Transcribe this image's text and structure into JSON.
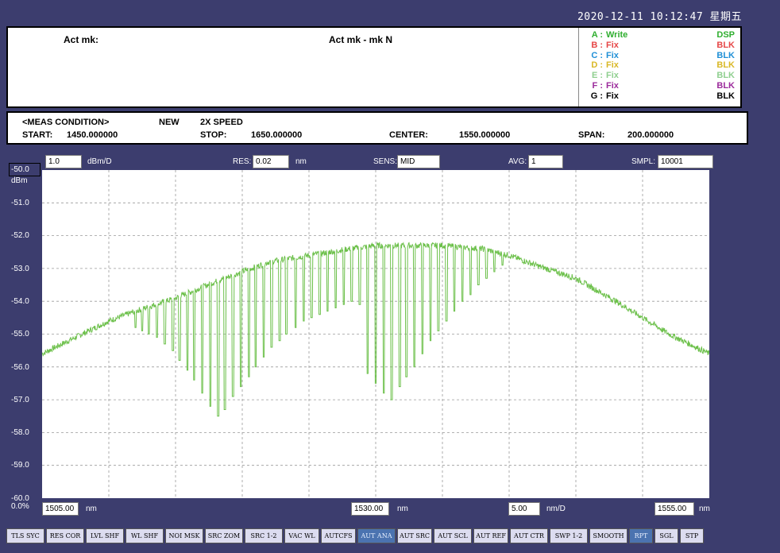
{
  "header": {
    "datetime": "2020-12-11 10:12:47 星期五"
  },
  "markers": {
    "act_mk": "Act mk:",
    "act_mk_n": "Act mk - mk N"
  },
  "traces": [
    {
      "letter": "A :",
      "mode": "Write",
      "display": "DSP",
      "color": "#2fae2f"
    },
    {
      "letter": "B :",
      "mode": "Fix",
      "display": "BLK",
      "color": "#e64646"
    },
    {
      "letter": "C :",
      "mode": "Fix",
      "display": "BLK",
      "color": "#1f8fd6"
    },
    {
      "letter": "D :",
      "mode": "Fix",
      "display": "BLK",
      "color": "#d9b826"
    },
    {
      "letter": "E :",
      "mode": "Fix",
      "display": "BLK",
      "color": "#8fcf8f"
    },
    {
      "letter": "F :",
      "mode": "Fix",
      "display": "BLK",
      "color": "#9b2a9b"
    },
    {
      "letter": "G :",
      "mode": "Fix",
      "display": "BLK",
      "color": "#000000"
    }
  ],
  "condition": {
    "title": "<MEAS CONDITION>",
    "new": "NEW",
    "speed": "2X SPEED",
    "start_label": "START:",
    "start": "1450.000000",
    "stop_label": "STOP:",
    "stop": "1650.000000",
    "center_label": "CENTER:",
    "center": "1550.000000",
    "span_label": "SPAN:",
    "span": "200.000000"
  },
  "top_fields": {
    "level_scale": "1.0",
    "level_unit": "dBm/D",
    "res_label": "RES:",
    "res": "0.02",
    "res_unit": "nm",
    "sens_label": "SENS:",
    "sens": "MID",
    "avg_label": "AVG:",
    "avg": "1",
    "smpl_label": "SMPL:",
    "smpl": "10001"
  },
  "y_axis": {
    "ref": "-50.0",
    "unit": "dBm",
    "ticks": [
      "-51.0",
      "-52.0",
      "-53.0",
      "-54.0",
      "-55.0",
      "-56.0",
      "-57.0",
      "-58.0",
      "-59.0",
      "-60.0"
    ],
    "bottom": "0.0%"
  },
  "bottom_fields": {
    "start": "1505.00",
    "start_unit": "nm",
    "center": "1530.00",
    "center_unit": "nm",
    "scale": "5.00",
    "scale_unit": "nm/D",
    "stop": "1555.00",
    "stop_unit": "nm"
  },
  "buttons": [
    {
      "label": "TLS SYC",
      "active": false
    },
    {
      "label": "RES COR",
      "active": false
    },
    {
      "label": "LVL SHF",
      "active": false
    },
    {
      "label": "WL SHF",
      "active": false
    },
    {
      "label": "NOI MSK",
      "active": false
    },
    {
      "label": "SRC ZOM",
      "active": false
    },
    {
      "label": "SRC 1-2",
      "active": false
    },
    {
      "label": "VAC WL",
      "active": false
    },
    {
      "label": "AUTCFS",
      "active": false
    },
    {
      "label": "AUT ANA",
      "active": true
    },
    {
      "label": "AUT SRC",
      "active": false
    },
    {
      "label": "AUT SCL",
      "active": false
    },
    {
      "label": "AUT REF",
      "active": false
    },
    {
      "label": "AUT CTR",
      "active": false
    },
    {
      "label": "SWP 1-2",
      "active": false
    },
    {
      "label": "SMOOTH",
      "active": false
    },
    {
      "label": "RPT",
      "active": true
    },
    {
      "label": "SGL",
      "active": false
    },
    {
      "label": "STP",
      "active": false
    }
  ],
  "chart_data": {
    "type": "line",
    "title": "",
    "xlabel": "nm",
    "ylabel": "dBm",
    "xlim": [
      1505,
      1555
    ],
    "ylim": [
      -60,
      -50
    ],
    "grid": true,
    "series": [
      {
        "color": "#6cc04a",
        "envelope_x": [
          1505,
          1508,
          1510,
          1512,
          1515,
          1518,
          1520,
          1522,
          1525,
          1528,
          1530,
          1532,
          1535,
          1538,
          1540,
          1542,
          1545,
          1548,
          1550,
          1552,
          1555
        ],
        "envelope_y": [
          -55.6,
          -55.0,
          -54.6,
          -54.3,
          -53.9,
          -53.4,
          -53.1,
          -52.8,
          -52.6,
          -52.4,
          -52.3,
          -52.3,
          -52.3,
          -52.4,
          -52.6,
          -52.9,
          -53.3,
          -54.0,
          -54.5,
          -55.0,
          -55.6
        ],
        "dips": [
          [
            1512.0,
            -54.8
          ],
          [
            1512.5,
            -54.9
          ],
          [
            1513.0,
            -55.0
          ],
          [
            1513.6,
            -55.1
          ],
          [
            1514.2,
            -55.3
          ],
          [
            1514.8,
            -55.5
          ],
          [
            1515.3,
            -55.8
          ],
          [
            1515.9,
            -56.1
          ],
          [
            1516.4,
            -56.4
          ],
          [
            1517.0,
            -56.8
          ],
          [
            1517.6,
            -57.2
          ],
          [
            1518.2,
            -57.5
          ],
          [
            1518.7,
            -57.3
          ],
          [
            1519.3,
            -56.9
          ],
          [
            1519.9,
            -56.6
          ],
          [
            1520.5,
            -56.3
          ],
          [
            1521.0,
            -56.0
          ],
          [
            1521.6,
            -55.7
          ],
          [
            1522.2,
            -55.4
          ],
          [
            1522.8,
            -55.2
          ],
          [
            1523.3,
            -55.0
          ],
          [
            1524.0,
            -54.8
          ],
          [
            1524.6,
            -54.6
          ],
          [
            1525.2,
            -54.5
          ],
          [
            1525.8,
            -54.4
          ],
          [
            1526.4,
            -54.3
          ],
          [
            1527.0,
            -54.2
          ],
          [
            1527.6,
            -54.1
          ],
          [
            1528.2,
            -54.0
          ],
          [
            1528.8,
            -54.1
          ],
          [
            1529.4,
            -56.2
          ],
          [
            1530.0,
            -56.5
          ],
          [
            1530.6,
            -56.8
          ],
          [
            1531.2,
            -57.0
          ],
          [
            1531.8,
            -56.6
          ],
          [
            1532.3,
            -56.3
          ],
          [
            1532.9,
            -56.0
          ],
          [
            1533.5,
            -55.6
          ],
          [
            1534.1,
            -55.2
          ],
          [
            1534.7,
            -54.9
          ],
          [
            1535.3,
            -54.6
          ],
          [
            1535.9,
            -54.3
          ],
          [
            1536.5,
            -54.0
          ],
          [
            1537.1,
            -53.8
          ],
          [
            1537.7,
            -53.5
          ],
          [
            1538.3,
            -53.3
          ],
          [
            1538.9,
            -53.1
          ],
          [
            1539.5,
            -52.9
          ]
        ]
      }
    ]
  }
}
